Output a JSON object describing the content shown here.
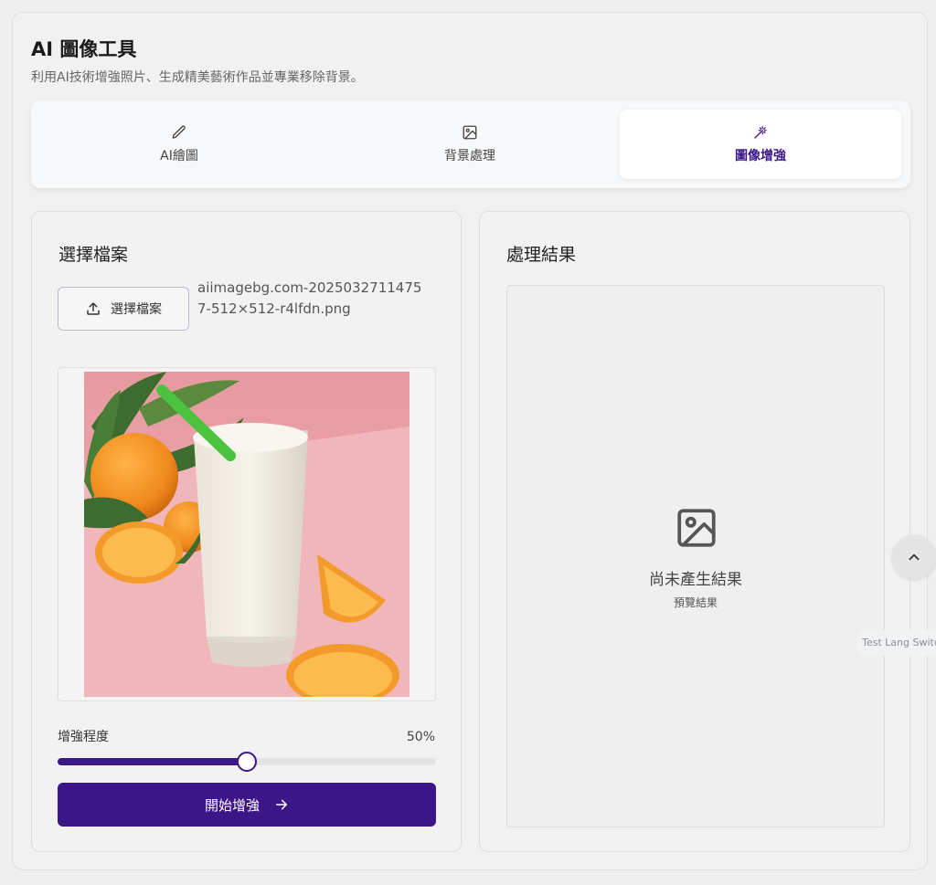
{
  "header": {
    "title": "AI 圖像工具",
    "subtitle": "利用AI技術增強照片、生成精美藝術作品並專業移除背景。"
  },
  "tabs": [
    {
      "label": "AI繪圖",
      "icon": "pencil-icon",
      "active": false
    },
    {
      "label": "背景處理",
      "icon": "image-icon",
      "active": false
    },
    {
      "label": "圖像增強",
      "icon": "magic-wand-icon",
      "active": true
    }
  ],
  "left_panel": {
    "title": "選擇檔案",
    "file_button_label": "選擇檔案",
    "file_name": "aiimagebg.com-20250327114757-512×512-r4lfdn.png",
    "slider": {
      "label": "增強程度",
      "value_text": "50%",
      "value": 50,
      "min": 0,
      "max": 100
    },
    "start_button_label": "開始增強"
  },
  "right_panel": {
    "title": "處理結果",
    "empty_text": "尚未產生結果",
    "empty_subtext": "預覽結果"
  },
  "floating": {
    "scroll_top_icon": "chevron-up-icon",
    "lang_switch_label": "Test Lang Switch"
  },
  "colors": {
    "accent": "#3c1586",
    "background": "#f1f1f1"
  }
}
